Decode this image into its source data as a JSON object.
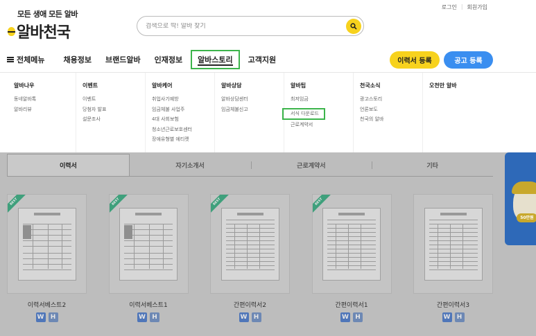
{
  "util_links": {
    "login": "로그인",
    "signup": "회원가입"
  },
  "logo": {
    "tagline": "모든 생애 모든 알바",
    "brand": "알바천국"
  },
  "search": {
    "placeholder": "검색으로 딱! 알바 찾기",
    "icon": "search-icon"
  },
  "nav": {
    "all_menu": "전체메뉴",
    "items": [
      "채용정보",
      "브랜드알바",
      "인재정보",
      "알바스토리",
      "고객지원"
    ],
    "active_index": 3,
    "resume_button": "이력서 등록",
    "post_button": "공고 등록"
  },
  "mega_menu": [
    {
      "title": "알바나우",
      "links": [
        "동네알바톡",
        "알바리뷰"
      ]
    },
    {
      "title": "이벤트",
      "links": [
        "이벤트",
        "당첨자 발표",
        "설문조사"
      ]
    },
    {
      "title": "알바케어",
      "links": [
        "취업사기예방",
        "임금체불 사업주",
        "4대 사회보험",
        "청소년근로보호센터",
        "장애유형별 에티켓"
      ]
    },
    {
      "title": "알바상담",
      "links": [
        "알바상담센터",
        "임금체불신고"
      ]
    },
    {
      "title": "알바팁",
      "links": [
        "최저임금",
        "서식 다운로드",
        "근로계약서"
      ],
      "highlight_index": 1
    },
    {
      "title": "천국소식",
      "links": [
        "광고스토리",
        "언론보도",
        "천국의 알바"
      ]
    },
    {
      "title": "오천만 알바",
      "links": []
    }
  ],
  "doc_tabs": [
    "이력서",
    "자기소개서",
    "근로계약서",
    "기타"
  ],
  "active_tab": 0,
  "cards": [
    {
      "title": "이력서베스트2",
      "badge": "BEST",
      "formats": [
        "W",
        "H"
      ]
    },
    {
      "title": "이력서베스트1",
      "badge": "BEST",
      "formats": [
        "W",
        "H"
      ]
    },
    {
      "title": "간편이력서2",
      "badge": "BEST",
      "formats": [
        "W",
        "H"
      ]
    },
    {
      "title": "간편이력서1",
      "badge": "BEST",
      "formats": [
        "W",
        "H"
      ]
    },
    {
      "title": "간편이력서3",
      "badge": "",
      "formats": [
        "W",
        "H"
      ]
    }
  ],
  "banner": {
    "amount": "50만원"
  },
  "colors": {
    "accent_yellow": "#f7d21d",
    "accent_blue": "#3a8ef0",
    "highlight_green": "#3cb44b"
  }
}
